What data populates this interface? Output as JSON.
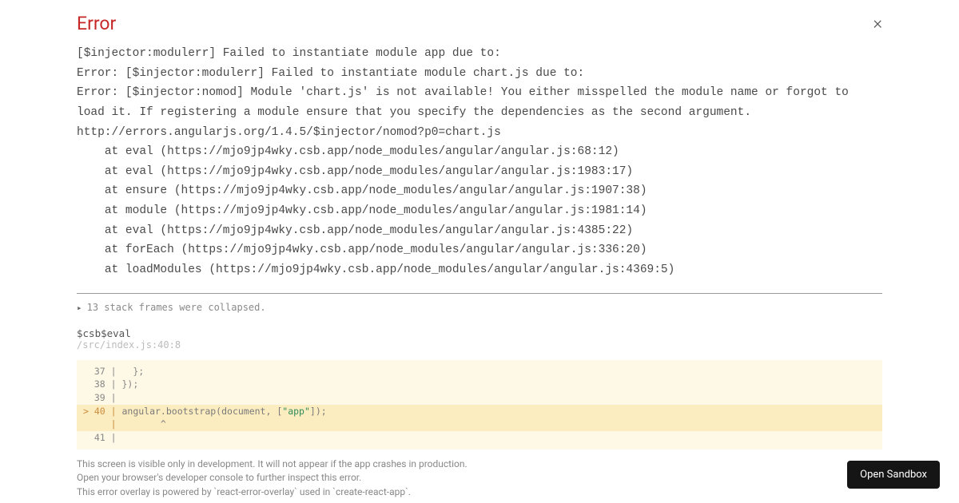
{
  "header": {
    "title": "Error",
    "close": "×"
  },
  "error": {
    "lines": [
      "[$injector:modulerr] Failed to instantiate module app due to:",
      "Error: [$injector:modulerr] Failed to instantiate module chart.js due to:",
      "Error: [$injector:nomod] Module 'chart.js' is not available! You either misspelled the module name or forgot to load it. If registering a module ensure that you specify the dependencies as the second argument.",
      "http://errors.angularjs.org/1.4.5/$injector/nomod?p0=chart.js",
      "    at eval (https://mjo9jp4wky.csb.app/node_modules/angular/angular.js:68:12)",
      "    at eval (https://mjo9jp4wky.csb.app/node_modules/angular/angular.js:1983:17)",
      "    at ensure (https://mjo9jp4wky.csb.app/node_modules/angular/angular.js:1907:38)",
      "    at module (https://mjo9jp4wky.csb.app/node_modules/angular/angular.js:1981:14)",
      "    at eval (https://mjo9jp4wky.csb.app/node_modules/angular/angular.js:4385:22)",
      "    at forEach (https://mjo9jp4wky.csb.app/node_modules/angular/angular.js:336:20)",
      "    at loadModules (https://mjo9jp4wky.csb.app/node_modules/angular/angular.js:4369:5)"
    ]
  },
  "collapsed": {
    "text": "13 stack frames were collapsed."
  },
  "frame": {
    "name": "$csb$eval",
    "location": "/src/index.js:40:8"
  },
  "code": {
    "lines": [
      {
        "gutter": "  37 |",
        "text": "   };"
      },
      {
        "gutter": "  38 |",
        "text": " });"
      },
      {
        "gutter": "  39 |",
        "text": ""
      },
      {
        "gutter": "> 40 |",
        "pre": " angular.bootstrap(document, [",
        "str": "\"app\"",
        "post": "]);",
        "hl": true
      },
      {
        "gutter": "     |",
        "text": "        ^",
        "hl": true
      },
      {
        "gutter": "  41 |",
        "text": ""
      }
    ]
  },
  "footer": {
    "l1": "This screen is visible only in development. It will not appear if the app crashes in production.",
    "l2": "Open your browser's developer console to further inspect this error.",
    "l3": "This error overlay is powered by `react-error-overlay` used in `create-react-app`."
  },
  "sandbox": {
    "label": "Open Sandbox"
  }
}
